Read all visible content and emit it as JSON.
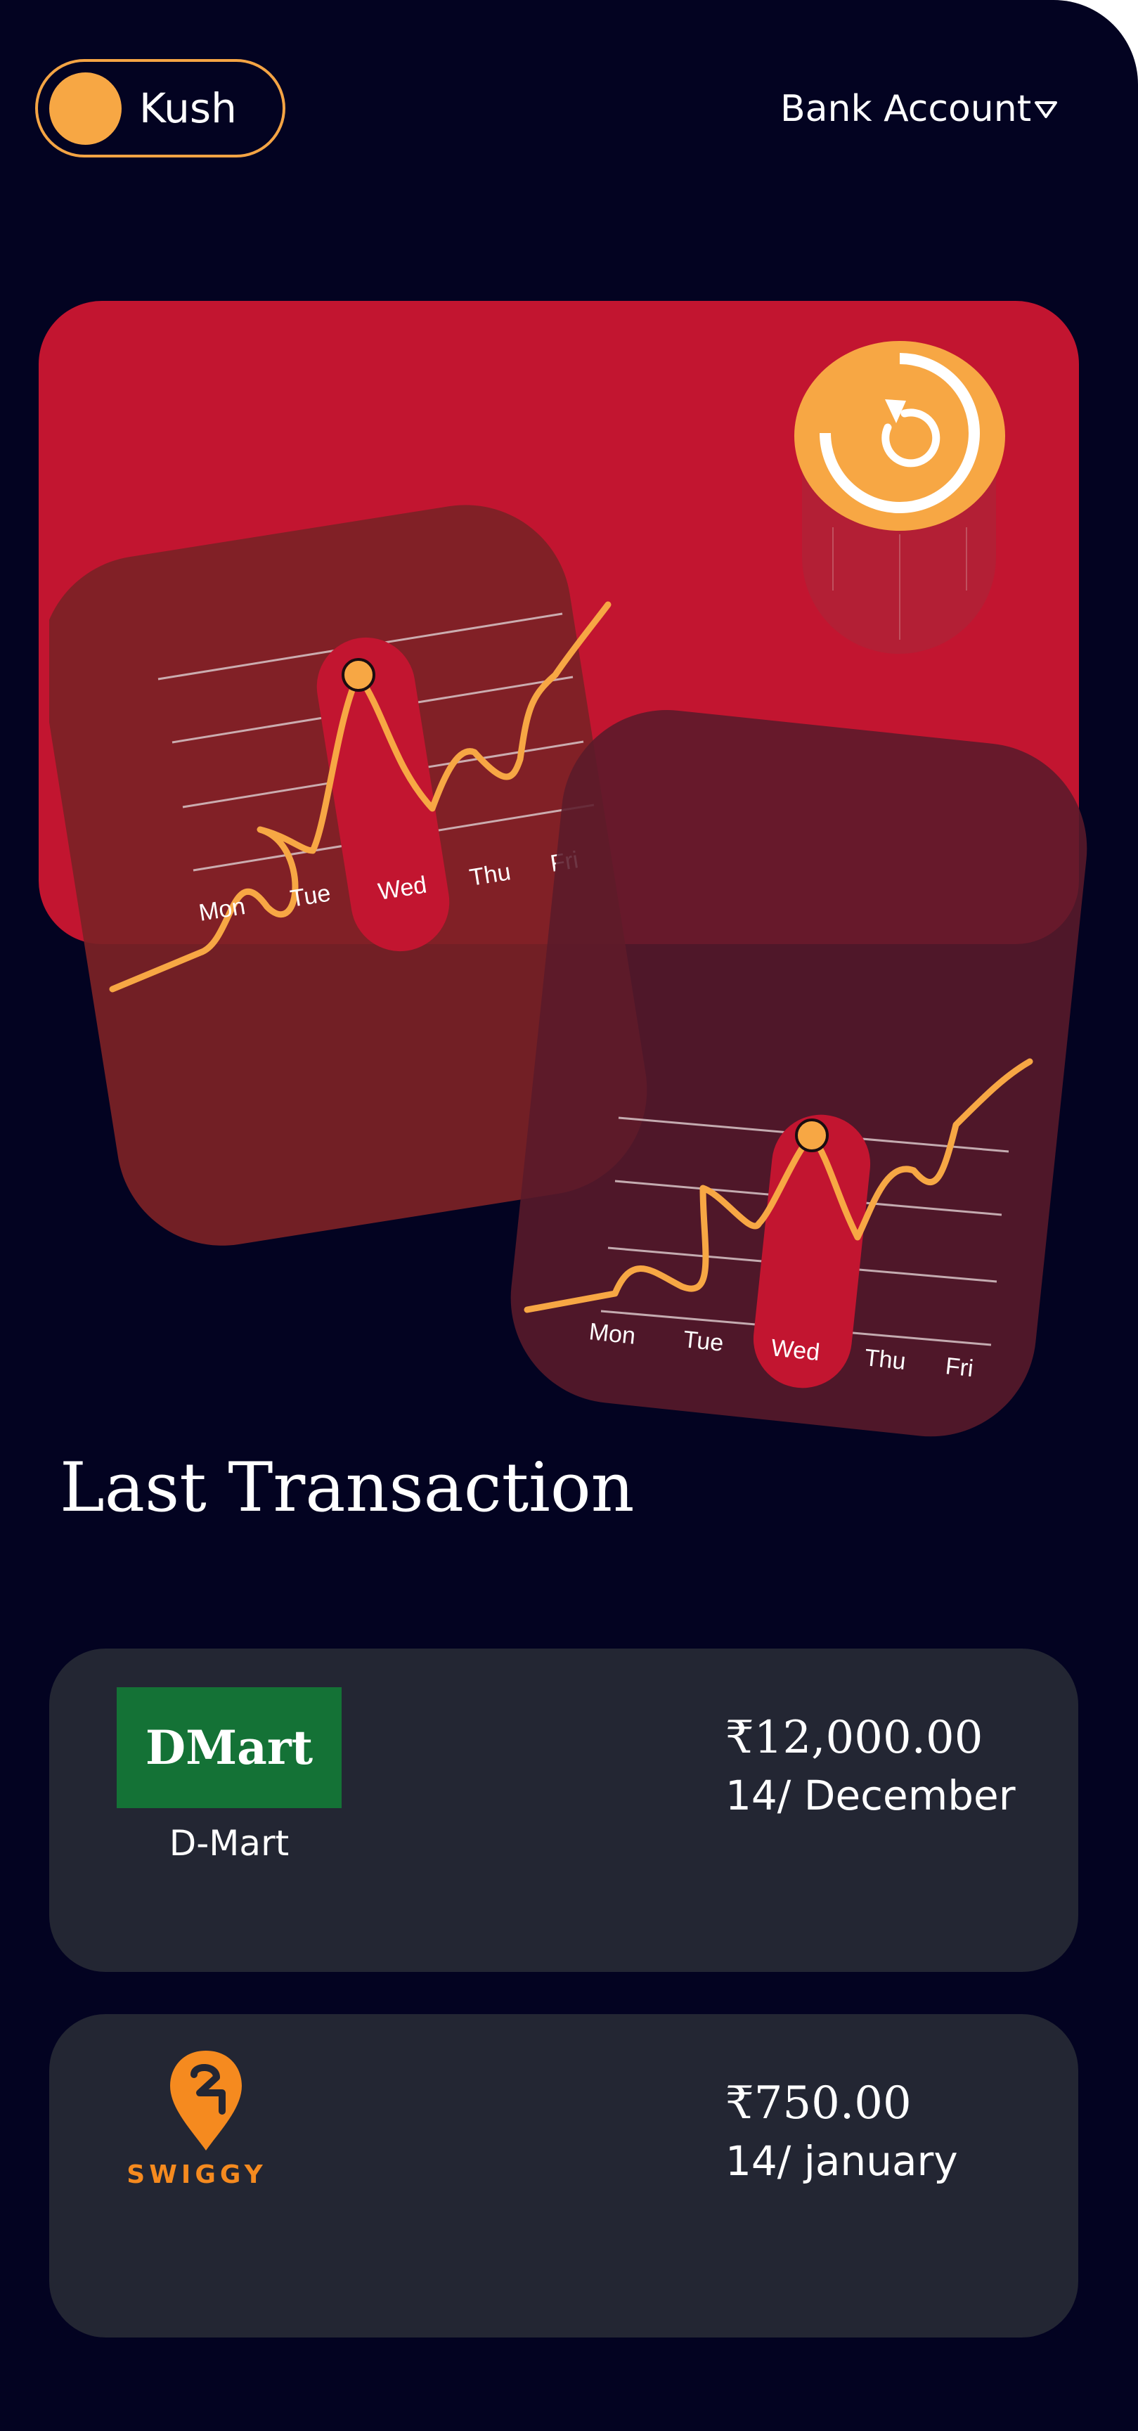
{
  "header": {
    "user_name": "Kush",
    "account_label": "Bank Account",
    "chevron_icon": "chevron-down-icon"
  },
  "hero": {
    "refresh_icon": "refresh-icon",
    "charts": [
      {
        "days": [
          "Mon",
          "Tue",
          "Wed",
          "Thu",
          "Fri"
        ],
        "highlighted": "Wed"
      },
      {
        "days": [
          "Mon",
          "Tue",
          "Wed",
          "Thu",
          "Fri"
        ],
        "highlighted": "Wed"
      }
    ]
  },
  "section_title": "Last Transaction",
  "transactions": [
    {
      "merchant": "D-Mart",
      "logo_text": "DMart",
      "amount": "₹12,000.00",
      "date": "14/ December"
    },
    {
      "merchant": "",
      "logo_text": "SWIGGY",
      "amount": "₹750.00",
      "date": "14/ january"
    }
  ],
  "colors": {
    "background": "#030321",
    "card_red": "#c21530",
    "accent_orange": "#f7a744",
    "tx_card": "#232633",
    "dmart_green": "#147236",
    "swiggy_orange": "#f58a1f"
  }
}
